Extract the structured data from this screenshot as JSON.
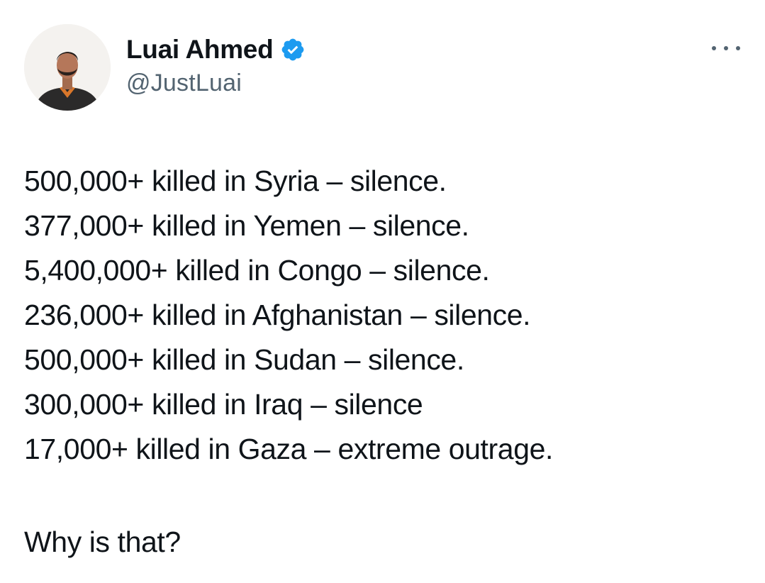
{
  "author": {
    "display_name": "Luai Ahmed",
    "handle": "@JustLuai",
    "verified": true,
    "verified_color": "#1d9bf0"
  },
  "menu": {
    "icon": "more-dots-icon"
  },
  "tweet": {
    "lines": [
      "500,000+ killed in Syria – silence.",
      "377,000+ killed in Yemen – silence.",
      "5,400,000+ killed in Congo – silence.",
      "236,000+ killed in Afghanistan – silence.",
      "500,000+ killed in Sudan – silence.",
      "300,000+ killed in Iraq – silence",
      "17,000+ killed in Gaza – extreme outrage."
    ],
    "question": "Why is that?"
  },
  "colors": {
    "text": "#0f1419",
    "secondary": "#536471",
    "background": "#ffffff"
  }
}
